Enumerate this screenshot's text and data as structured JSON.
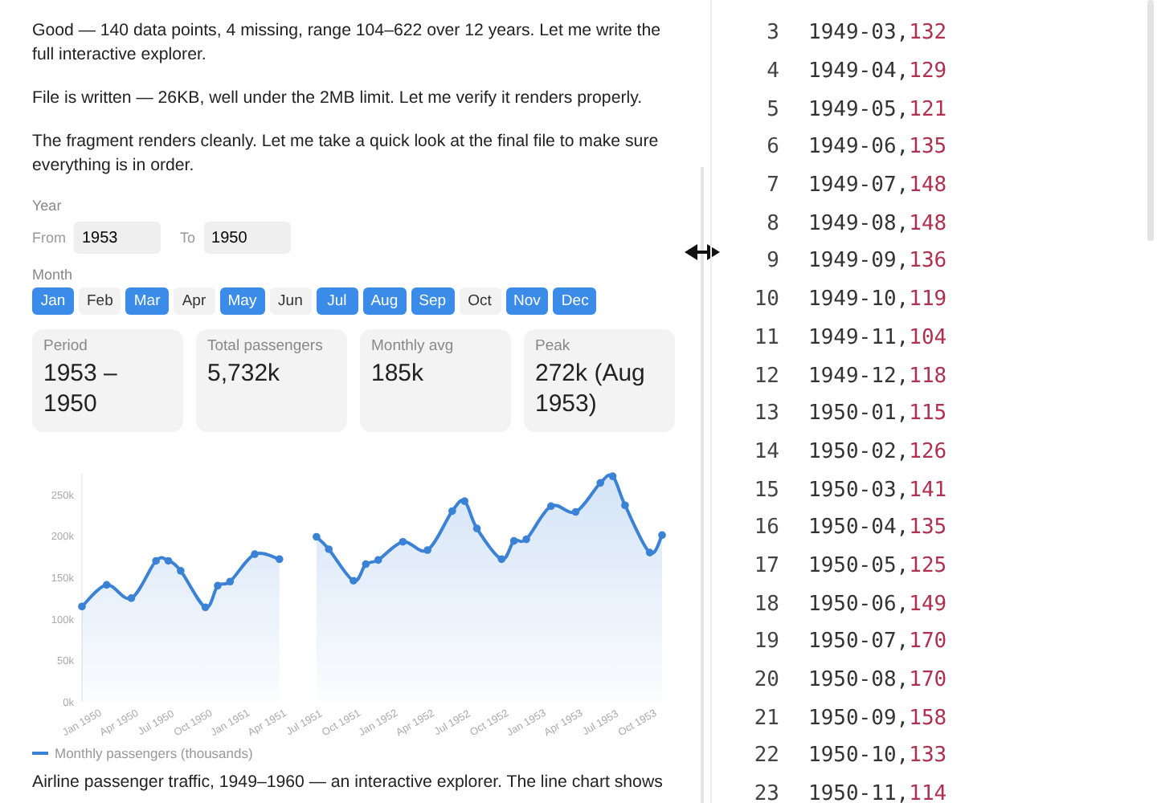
{
  "messages": [
    "Good — 140 data points, 4 missing, range 104–622 over 12 years. Let me write the full interactive explorer.",
    "File is written — 26KB, well under the 2MB limit. Let me verify it renders properly.",
    "The fragment renders cleanly. Let me take a quick look at the final file to make sure everything is in order."
  ],
  "year_filter": {
    "label": "Year",
    "from_label": "From",
    "from_value": "1953",
    "to_label": "To",
    "to_value": "1950"
  },
  "month_filter": {
    "label": "Month",
    "months": [
      {
        "label": "Jan",
        "selected": true
      },
      {
        "label": "Feb",
        "selected": false
      },
      {
        "label": "Mar",
        "selected": true
      },
      {
        "label": "Apr",
        "selected": false
      },
      {
        "label": "May",
        "selected": true
      },
      {
        "label": "Jun",
        "selected": false
      },
      {
        "label": "Jul",
        "selected": true
      },
      {
        "label": "Aug",
        "selected": true
      },
      {
        "label": "Sep",
        "selected": true
      },
      {
        "label": "Oct",
        "selected": false
      },
      {
        "label": "Nov",
        "selected": true
      },
      {
        "label": "Dec",
        "selected": true
      }
    ]
  },
  "stats": [
    {
      "label": "Period",
      "value": "1953 – 1950"
    },
    {
      "label": "Total passengers",
      "value": "5,732k"
    },
    {
      "label": "Monthly avg",
      "value": "185k"
    },
    {
      "label": "Peak",
      "value": "272k (Aug 1953)"
    }
  ],
  "chart": {
    "chart_data": {
      "type": "area",
      "categories": [
        "Jan 1950",
        null,
        null,
        "Apr 1950",
        null,
        null,
        "Jul 1950",
        null,
        null,
        "Oct 1950",
        null,
        null,
        "Jan 1951",
        null,
        null,
        "Apr 1951",
        null,
        null,
        "Jul 1951",
        null,
        null,
        "Oct 1951",
        null,
        null,
        "Jan 1952",
        null,
        null,
        "Apr 1952",
        null,
        null,
        "Jul 1952",
        null,
        null,
        "Oct 1952",
        null,
        null,
        "Jan 1953",
        null,
        null,
        "Apr 1953",
        null,
        null,
        "Jul 1953",
        null,
        null,
        "Oct 1953",
        null,
        null
      ],
      "series": [
        {
          "name": "Monthly passengers (thousands)",
          "color": "#3b82d6",
          "values": [
            115,
            null,
            141,
            null,
            125,
            null,
            170,
            170,
            158,
            null,
            114,
            140,
            145,
            null,
            178,
            null,
            172,
            null,
            null,
            199,
            184,
            null,
            146,
            166,
            171,
            null,
            193,
            null,
            183,
            null,
            230,
            242,
            209,
            null,
            172,
            194,
            196,
            null,
            236,
            null,
            229,
            null,
            264,
            272,
            237,
            null,
            180,
            201
          ]
        }
      ],
      "ylim": [
        0,
        275
      ],
      "yticks": [
        {
          "value": 0,
          "label": "0k"
        },
        {
          "value": 50,
          "label": "50k"
        },
        {
          "value": 100,
          "label": "100k"
        },
        {
          "value": 150,
          "label": "150k"
        },
        {
          "value": 200,
          "label": "200k"
        },
        {
          "value": 250,
          "label": "250k"
        }
      ]
    }
  },
  "description": "Airline passenger traffic, 1949–1960 — an interactive explorer. The line chart shows",
  "code_lines": [
    {
      "number": "3",
      "key": "1949-03,",
      "value": "132"
    },
    {
      "number": "4",
      "key": "1949-04,",
      "value": "129"
    },
    {
      "number": "5",
      "key": "1949-05,",
      "value": "121"
    },
    {
      "number": "6",
      "key": "1949-06,",
      "value": "135"
    },
    {
      "number": "7",
      "key": "1949-07,",
      "value": "148"
    },
    {
      "number": "8",
      "key": "1949-08,",
      "value": "148"
    },
    {
      "number": "9",
      "key": "1949-09,",
      "value": "136"
    },
    {
      "number": "10",
      "key": "1949-10,",
      "value": "119"
    },
    {
      "number": "11",
      "key": "1949-11,",
      "value": "104"
    },
    {
      "number": "12",
      "key": "1949-12,",
      "value": "118"
    },
    {
      "number": "13",
      "key": "1950-01,",
      "value": "115"
    },
    {
      "number": "14",
      "key": "1950-02,",
      "value": "126"
    },
    {
      "number": "15",
      "key": "1950-03,",
      "value": "141"
    },
    {
      "number": "16",
      "key": "1950-04,",
      "value": "135"
    },
    {
      "number": "17",
      "key": "1950-05,",
      "value": "125"
    },
    {
      "number": "18",
      "key": "1950-06,",
      "value": "149"
    },
    {
      "number": "19",
      "key": "1950-07,",
      "value": "170"
    },
    {
      "number": "20",
      "key": "1950-08,",
      "value": "170"
    },
    {
      "number": "21",
      "key": "1950-09,",
      "value": "158"
    },
    {
      "number": "22",
      "key": "1950-10,",
      "value": "133"
    },
    {
      "number": "23",
      "key": "1950-11,",
      "value": "114"
    }
  ]
}
